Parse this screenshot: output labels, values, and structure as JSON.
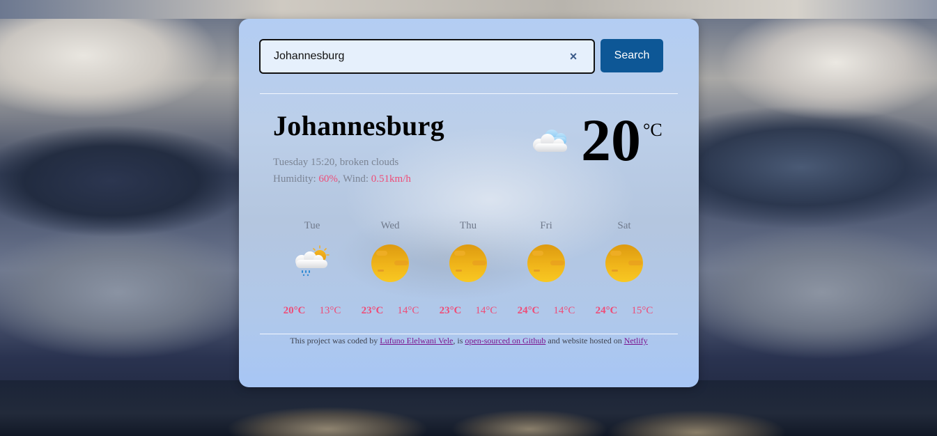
{
  "search": {
    "value": "Johannesburg",
    "clear_label": "×",
    "button_label": "Search"
  },
  "current": {
    "city": "Johannesburg",
    "datetime_description": "Tuesday 15:20, broken clouds",
    "humidity_label": "Humidity: ",
    "humidity_value": "60%",
    "wind_label": ", Wind: ",
    "wind_value": "0.51km/h",
    "temperature": "20",
    "unit": "°C",
    "icon": "broken-clouds-icon"
  },
  "forecast": [
    {
      "day": "Tue",
      "icon": "rain-sun-cloud-icon",
      "max": "20°C",
      "min": "13°C"
    },
    {
      "day": "Wed",
      "icon": "sun-icon",
      "max": "23°C",
      "min": "14°C"
    },
    {
      "day": "Thu",
      "icon": "sun-icon",
      "max": "23°C",
      "min": "14°C"
    },
    {
      "day": "Fri",
      "icon": "sun-icon",
      "max": "24°C",
      "min": "14°C"
    },
    {
      "day": "Sat",
      "icon": "sun-icon",
      "max": "24°C",
      "min": "15°C"
    }
  ],
  "footer": {
    "text1": "This project was coded by ",
    "author_link": "Lufuno Elelwani Vele",
    "text2": ", is ",
    "github_link": "open-sourced on Github",
    "text3": " and website hosted on ",
    "netlify_link": "Netlify"
  },
  "colors": {
    "accent": "#ee4d78",
    "button": "#0d5796",
    "link": "#7b138d"
  }
}
